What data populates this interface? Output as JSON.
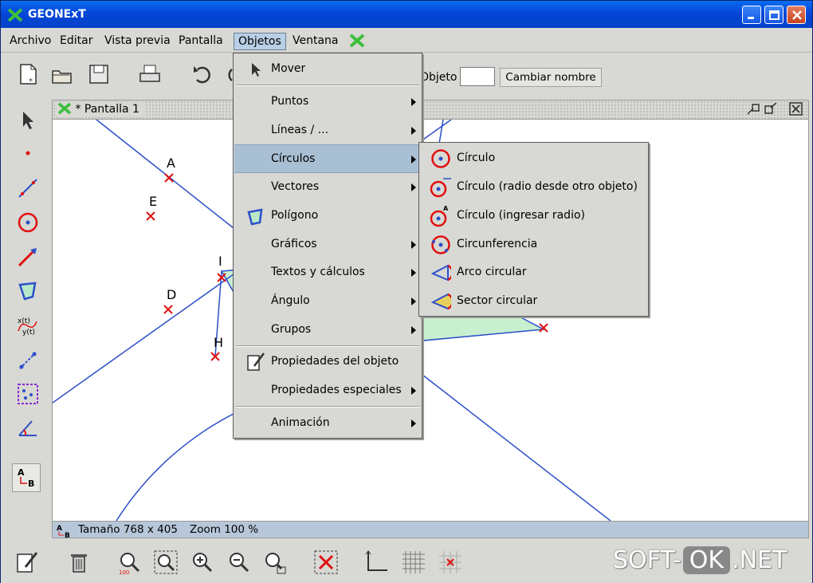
{
  "window": {
    "title": "GEONExT"
  },
  "menubar": [
    {
      "label": "Archivo"
    },
    {
      "label": "Editar"
    },
    {
      "label": "Vista previa"
    },
    {
      "label": "Pantalla"
    },
    {
      "label": "Objetos"
    },
    {
      "label": "Ventana"
    }
  ],
  "toolbar": {
    "object_label": "Objeto",
    "object_value": "",
    "rename_button": "Cambiar nombre"
  },
  "inner_window": {
    "title": "* Pantalla  1"
  },
  "canvas_points": [
    "A",
    "E",
    "D",
    "I",
    "H"
  ],
  "statusbar": {
    "size": "Tamaño 768 x 405",
    "zoom": "Zoom 100 %"
  },
  "objects_menu": [
    {
      "label": "Mover",
      "submenu": false
    },
    {
      "label": "Puntos",
      "submenu": true
    },
    {
      "label": "Líneas / ...",
      "submenu": true
    },
    {
      "label": "Círculos",
      "submenu": true,
      "highlighted": true
    },
    {
      "label": "Vectores",
      "submenu": true
    },
    {
      "label": "Polígono",
      "submenu": false
    },
    {
      "label": "Gráficos",
      "submenu": true
    },
    {
      "label": "Textos y cálculos",
      "submenu": true
    },
    {
      "label": "Ángulo",
      "submenu": true
    },
    {
      "label": "Grupos",
      "submenu": true
    },
    {
      "label": "Propiedades del objeto",
      "submenu": false
    },
    {
      "label": "Propiedades especiales",
      "submenu": true
    },
    {
      "label": "Animación",
      "submenu": true
    }
  ],
  "circles_submenu": [
    {
      "label": "Círculo"
    },
    {
      "label": "Círculo (radio desde otro objeto)"
    },
    {
      "label": "Círculo (ingresar radio)"
    },
    {
      "label": "Circunferencia"
    },
    {
      "label": "Arco circular"
    },
    {
      "label": "Sector circular"
    }
  ],
  "watermark": {
    "left": "SOFT-",
    "mid": "OK",
    "right": ".NET"
  },
  "colors": {
    "titlebar": "#0546d8",
    "menu_highlight": "#a9bfd3",
    "statusbar": "#b7c7d9",
    "line": "#2b4fc9",
    "point": "#e01010",
    "polygon_fill": "#c8f0d0"
  }
}
